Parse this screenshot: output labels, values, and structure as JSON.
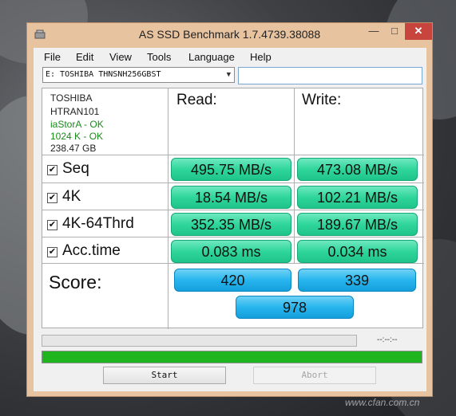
{
  "window": {
    "title": "AS SSD Benchmark 1.7.4739.38088",
    "minimize": "—",
    "maximize": "□",
    "close": "✕"
  },
  "menu": [
    "File",
    "Edit",
    "View",
    "Tools",
    "Language",
    "Help"
  ],
  "drive": {
    "selected": "E: TOSHIBA THNSNH256GBST",
    "path_value": ""
  },
  "info": {
    "vendor": "TOSHIBA",
    "firmware": "HTRAN101",
    "driver_status": "iaStorA - OK",
    "alignment_status": "1024 K - OK",
    "capacity": "238.47 GB"
  },
  "headers": {
    "read": "Read:",
    "write": "Write:"
  },
  "tests": [
    {
      "label": "Seq",
      "checked": true,
      "read": "495.75 MB/s",
      "write": "473.08 MB/s"
    },
    {
      "label": "4K",
      "checked": true,
      "read": "18.54 MB/s",
      "write": "102.21 MB/s"
    },
    {
      "label": "4K-64Thrd",
      "checked": true,
      "read": "352.35 MB/s",
      "write": "189.67 MB/s"
    },
    {
      "label": "Acc.time",
      "checked": true,
      "read": "0.083 ms",
      "write": "0.034 ms"
    }
  ],
  "score": {
    "label": "Score:",
    "read": "420",
    "write": "339",
    "total": "978"
  },
  "progress": {
    "elapsed": "--:--:--",
    "main_fraction": 1.0
  },
  "buttons": {
    "start": "Start",
    "abort": "Abort"
  },
  "watermark": "www.cfan.com.cn",
  "colors": {
    "window_frame": "#e8c3a0",
    "close_button": "#c7453c",
    "result_green": "#2fd69a",
    "score_blue": "#27b5ee",
    "progress_fill": "#1fb51f",
    "ok_text": "#1a8a1a"
  },
  "icons": {
    "app": "drive-icon",
    "checkbox_checked": "checkmark-icon"
  }
}
